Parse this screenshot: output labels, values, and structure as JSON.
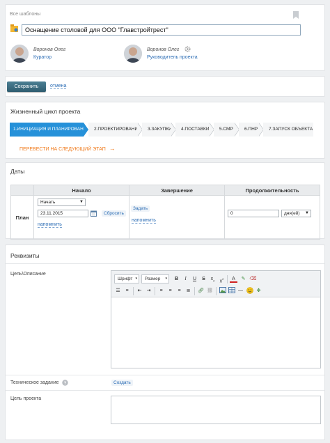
{
  "header": {
    "all_templates": "Все шаблоны",
    "project_title": "Оснащение столовой для ООО \"Главстройтрест\"",
    "people": [
      {
        "name": "Воронов Олег",
        "role": "Куратор"
      },
      {
        "name": "Воронов Олег",
        "role": "Руководитель проекта"
      }
    ]
  },
  "actions": {
    "save_label": "Сохранить",
    "cancel_label": "отмена"
  },
  "lifecycle": {
    "title": "Жизненный цикл проекта",
    "stages": [
      {
        "label": "1.ИНИЦИАЦИЯ И ПЛАНИРОВАНИЕ",
        "active": true
      },
      {
        "label": "2.ПРОЕКТИРОВАНИЕ",
        "active": false
      },
      {
        "label": "3.ЗАКУПКИ",
        "active": false
      },
      {
        "label": "4.ПОСТАВКИ",
        "active": false
      },
      {
        "label": "5.СМР",
        "active": false
      },
      {
        "label": "6.ПНР",
        "active": false
      },
      {
        "label": "7.ЗАПУСК ОБЪЕКТА",
        "active": false
      }
    ],
    "next_stage_label": "ПЕРЕВЕСТИ НА СЛЕДУЮЩИЙ ЭТАП"
  },
  "dates": {
    "title": "Даты",
    "columns": [
      "Начало",
      "Завершение",
      "Продолжительность"
    ],
    "row_label": "План",
    "start_mode": "Начать",
    "start_date": "23.11.2015",
    "reset_label": "Сбросить",
    "remind_label": "напомнить",
    "set_label": "Задать",
    "end_remind_label": "напомнить",
    "duration_value": "0",
    "duration_unit": "дня(ей)"
  },
  "requisites": {
    "title": "Реквизиты",
    "goal_desc_label": "Цель\\Описание",
    "font_label": "Шрифт",
    "size_label": "Размер",
    "tech_task_label": "Техническое задание",
    "create_label": "Создать",
    "project_goal_label": "Цель проекта"
  },
  "colors": {
    "accent": "#2691d9",
    "save_button": "#3a6b7f",
    "next_stage": "#f07c1f",
    "link": "#2c6db5"
  }
}
